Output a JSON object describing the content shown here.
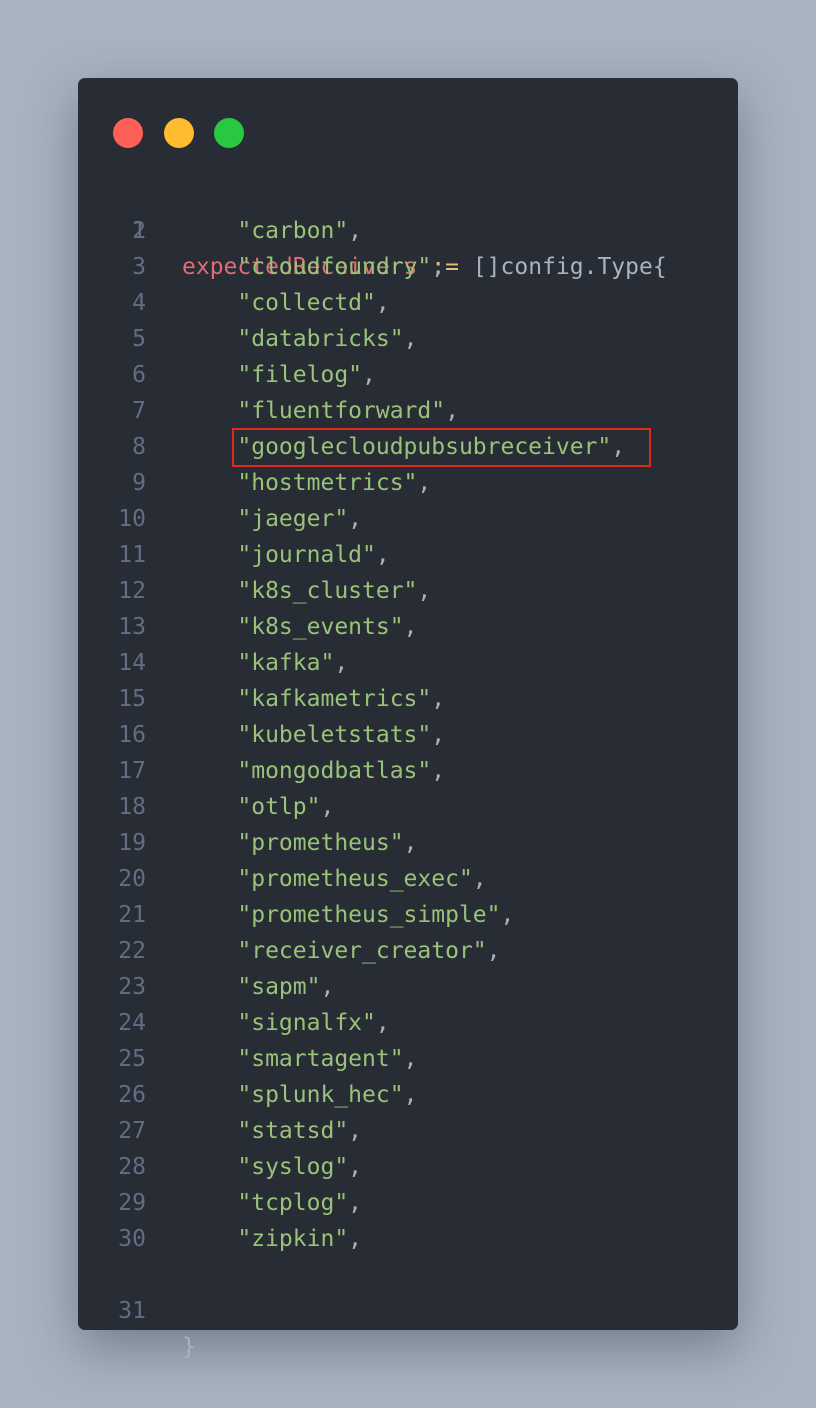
{
  "window": {
    "controls": {
      "close_color": "#fe5f57",
      "minimize_color": "#febc2e",
      "maximize_color": "#28c840"
    }
  },
  "code": {
    "header": {
      "number": "1",
      "variable": "expectedReceivers",
      "operator": ":=",
      "type_decl": "[]config.Type{"
    },
    "items": [
      {
        "number": "2",
        "value": "\"carbon\"",
        "suffix": ","
      },
      {
        "number": "3",
        "value": "\"cloudfoundry\"",
        "suffix": ","
      },
      {
        "number": "4",
        "value": "\"collectd\"",
        "suffix": ","
      },
      {
        "number": "5",
        "value": "\"databricks\"",
        "suffix": ","
      },
      {
        "number": "6",
        "value": "\"filelog\"",
        "suffix": ","
      },
      {
        "number": "7",
        "value": "\"fluentforward\"",
        "suffix": ","
      },
      {
        "number": "8",
        "value": "\"googlecloudpubsubreceiver\"",
        "suffix": ","
      },
      {
        "number": "9",
        "value": "\"hostmetrics\"",
        "suffix": ","
      },
      {
        "number": "10",
        "value": "\"jaeger\"",
        "suffix": ","
      },
      {
        "number": "11",
        "value": "\"journald\"",
        "suffix": ","
      },
      {
        "number": "12",
        "value": "\"k8s_cluster\"",
        "suffix": ","
      },
      {
        "number": "13",
        "value": "\"k8s_events\"",
        "suffix": ","
      },
      {
        "number": "14",
        "value": "\"kafka\"",
        "suffix": ","
      },
      {
        "number": "15",
        "value": "\"kafkametrics\"",
        "suffix": ","
      },
      {
        "number": "16",
        "value": "\"kubeletstats\"",
        "suffix": ","
      },
      {
        "number": "17",
        "value": "\"mongodbatlas\"",
        "suffix": ","
      },
      {
        "number": "18",
        "value": "\"otlp\"",
        "suffix": ","
      },
      {
        "number": "19",
        "value": "\"prometheus\"",
        "suffix": ","
      },
      {
        "number": "20",
        "value": "\"prometheus_exec\"",
        "suffix": ","
      },
      {
        "number": "21",
        "value": "\"prometheus_simple\"",
        "suffix": ","
      },
      {
        "number": "22",
        "value": "\"receiver_creator\"",
        "suffix": ","
      },
      {
        "number": "23",
        "value": "\"sapm\"",
        "suffix": ","
      },
      {
        "number": "24",
        "value": "\"signalfx\"",
        "suffix": ","
      },
      {
        "number": "25",
        "value": "\"smartagent\"",
        "suffix": ","
      },
      {
        "number": "26",
        "value": "\"splunk_hec\"",
        "suffix": ","
      },
      {
        "number": "27",
        "value": "\"statsd\"",
        "suffix": ","
      },
      {
        "number": "28",
        "value": "\"syslog\"",
        "suffix": ","
      },
      {
        "number": "29",
        "value": "\"tcplog\"",
        "suffix": ","
      },
      {
        "number": "30",
        "value": "\"zipkin\"",
        "suffix": ","
      }
    ],
    "closing": {
      "number": "31",
      "text": "}"
    },
    "highlight_color": "#e02a1a"
  }
}
